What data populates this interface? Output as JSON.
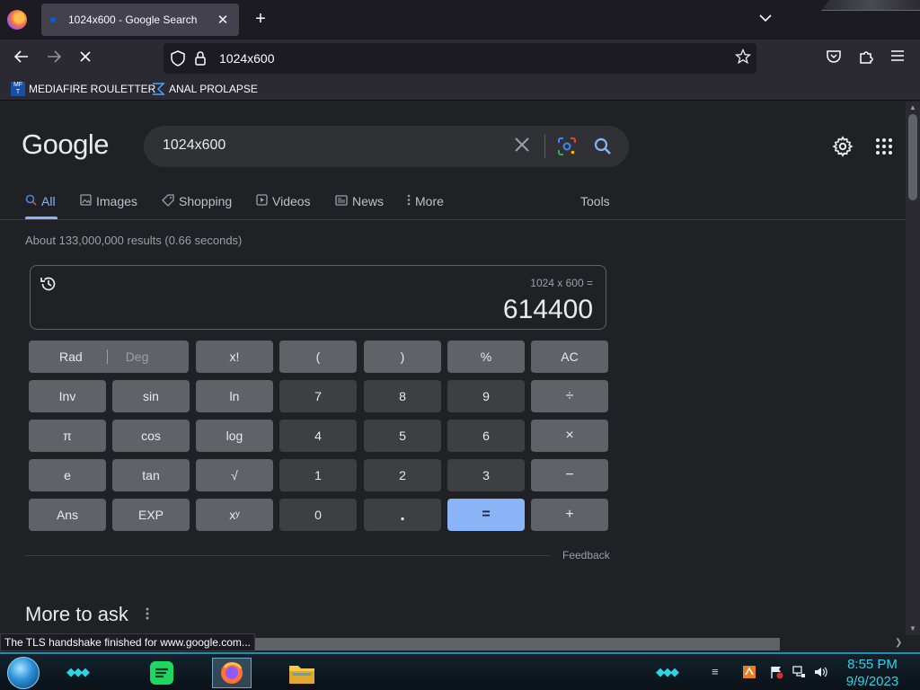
{
  "browser": {
    "tab_title": "1024x600 - Google Search",
    "tab_close": "✕",
    "new_tab": "+",
    "url": "1024x600",
    "bookmarks": [
      "MEDIAFIRE ROULETTER",
      "ANAL PROLAPSE"
    ],
    "bookmark_icon_text": "MF\nT"
  },
  "google": {
    "logo": "Google",
    "query": "1024x600",
    "tabs": [
      "All",
      "Images",
      "Shopping",
      "Videos",
      "News",
      "More"
    ],
    "tools": "Tools",
    "stats": "About 133,000,000 results (0.66 seconds)",
    "calculator": {
      "expression": "1024 x 600 =",
      "result": "614400",
      "keys": {
        "rad": "Rad",
        "deg": "Deg",
        "fact": "x!",
        "lparen": "(",
        "rparen": ")",
        "percent": "%",
        "ac": "AC",
        "inv": "Inv",
        "sin": "sin",
        "ln": "ln",
        "k7": "7",
        "k8": "8",
        "k9": "9",
        "div": "÷",
        "pi": "π",
        "cos": "cos",
        "log": "log",
        "k4": "4",
        "k5": "5",
        "k6": "6",
        "mul": "×",
        "e": "e",
        "tan": "tan",
        "sqrt": "√",
        "k1": "1",
        "k2": "2",
        "k3": "3",
        "minus": "−",
        "ans": "Ans",
        "exp": "EXP",
        "pow": "xʸ",
        "k0": "0",
        "dot": ".",
        "eq": "=",
        "plus": "+"
      }
    },
    "feedback": "Feedback",
    "more_to_ask": "More to ask"
  },
  "status_text": "The TLS handshake finished for www.google.com...",
  "taskbar": {
    "time": "8:55 PM",
    "date": "9/9/2023"
  },
  "colors": {
    "accent": "#8ab4f8",
    "page_bg": "#202124",
    "clock": "#2fd3e6"
  }
}
